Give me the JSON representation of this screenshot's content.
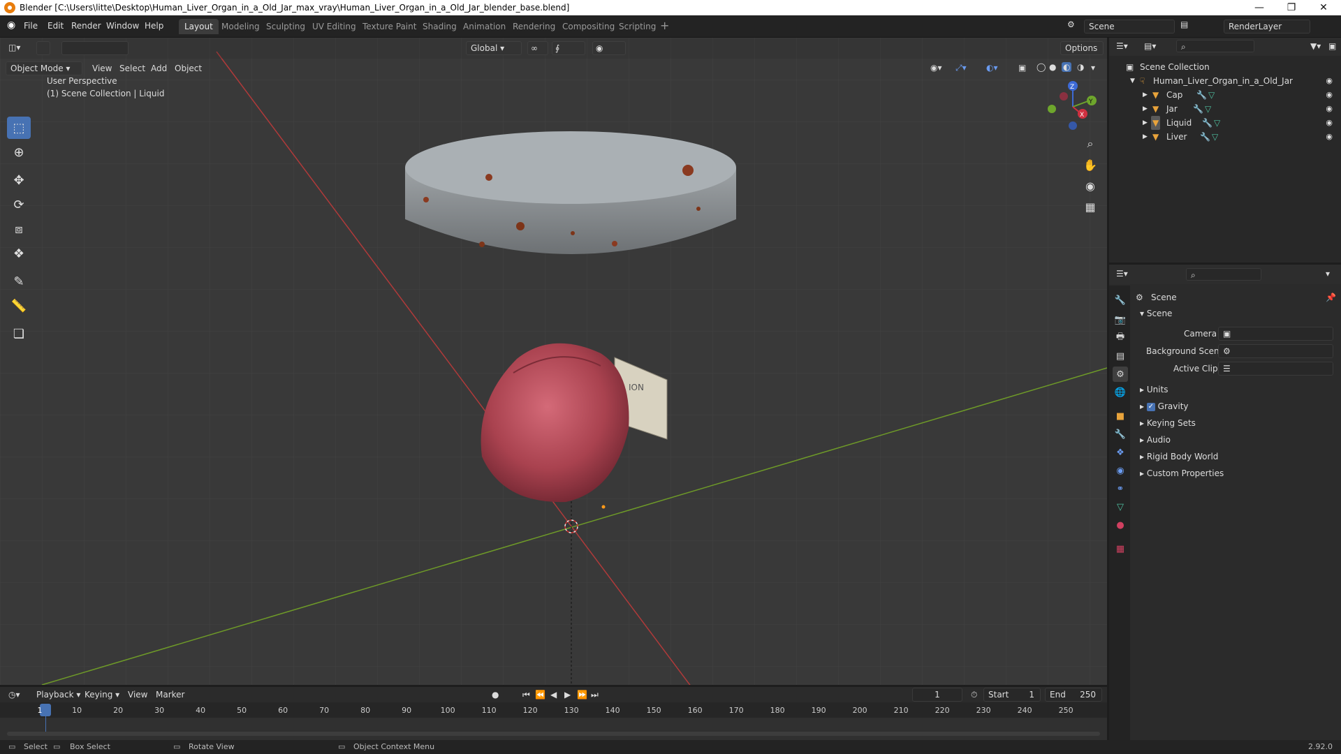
{
  "window": {
    "title": "Blender [C:\\Users\\litte\\Desktop\\Human_Liver_Organ_in_a_Old_Jar_max_vray\\Human_Liver_Organ_in_a_Old_Jar_blender_base.blend]",
    "version": "2.92.0"
  },
  "menu": [
    "File",
    "Edit",
    "Render",
    "Window",
    "Help"
  ],
  "workspaces": [
    "Layout",
    "Modeling",
    "Sculpting",
    "UV Editing",
    "Texture Paint",
    "Shading",
    "Animation",
    "Rendering",
    "Compositing",
    "Scripting"
  ],
  "scene_field": "Scene",
  "renderlayer_field": "RenderLayer",
  "viewport": {
    "mode": "Object Mode",
    "menus": [
      "View",
      "Select",
      "Add",
      "Object"
    ],
    "transform": "Global",
    "options": "Options",
    "overlay_line1": "User Perspective",
    "overlay_line2": "(1) Scene Collection | Liquid",
    "gizmo": {
      "x": "X",
      "y": "Y",
      "z": "Z"
    },
    "jar_label": "ION"
  },
  "outliner": {
    "root": "Scene Collection",
    "collection": "Human_Liver_Organ_in_a_Old_Jar",
    "objects": [
      "Cap",
      "Jar",
      "Liquid",
      "Liver"
    ]
  },
  "properties": {
    "context": "Scene",
    "panel": "Scene",
    "fields": {
      "camera": "Camera",
      "background_scene": "Background Scene",
      "active_clip": "Active Clip"
    },
    "sections": [
      "Units",
      "Gravity",
      "Keying Sets",
      "Audio",
      "Rigid Body World",
      "Custom Properties"
    ],
    "gravity_checked": true
  },
  "timeline": {
    "menus": [
      "Playback",
      "Keying",
      "View",
      "Marker"
    ],
    "current_frame": "1",
    "start_label": "Start",
    "start": "1",
    "end_label": "End",
    "end": "250",
    "ticks": [
      "1",
      "10",
      "20",
      "30",
      "40",
      "50",
      "60",
      "70",
      "80",
      "90",
      "100",
      "110",
      "120",
      "130",
      "140",
      "150",
      "160",
      "170",
      "180",
      "190",
      "200",
      "210",
      "220",
      "230",
      "240",
      "250"
    ]
  },
  "status": {
    "select": "Select",
    "box_select": "Box Select",
    "rotate_view": "Rotate View",
    "context_menu": "Object Context Menu"
  },
  "colors": {
    "accent": "#4772b3",
    "x_axis": "#c83a3a",
    "y_axis": "#7ea82c",
    "object_icon": "#e8a33b"
  }
}
